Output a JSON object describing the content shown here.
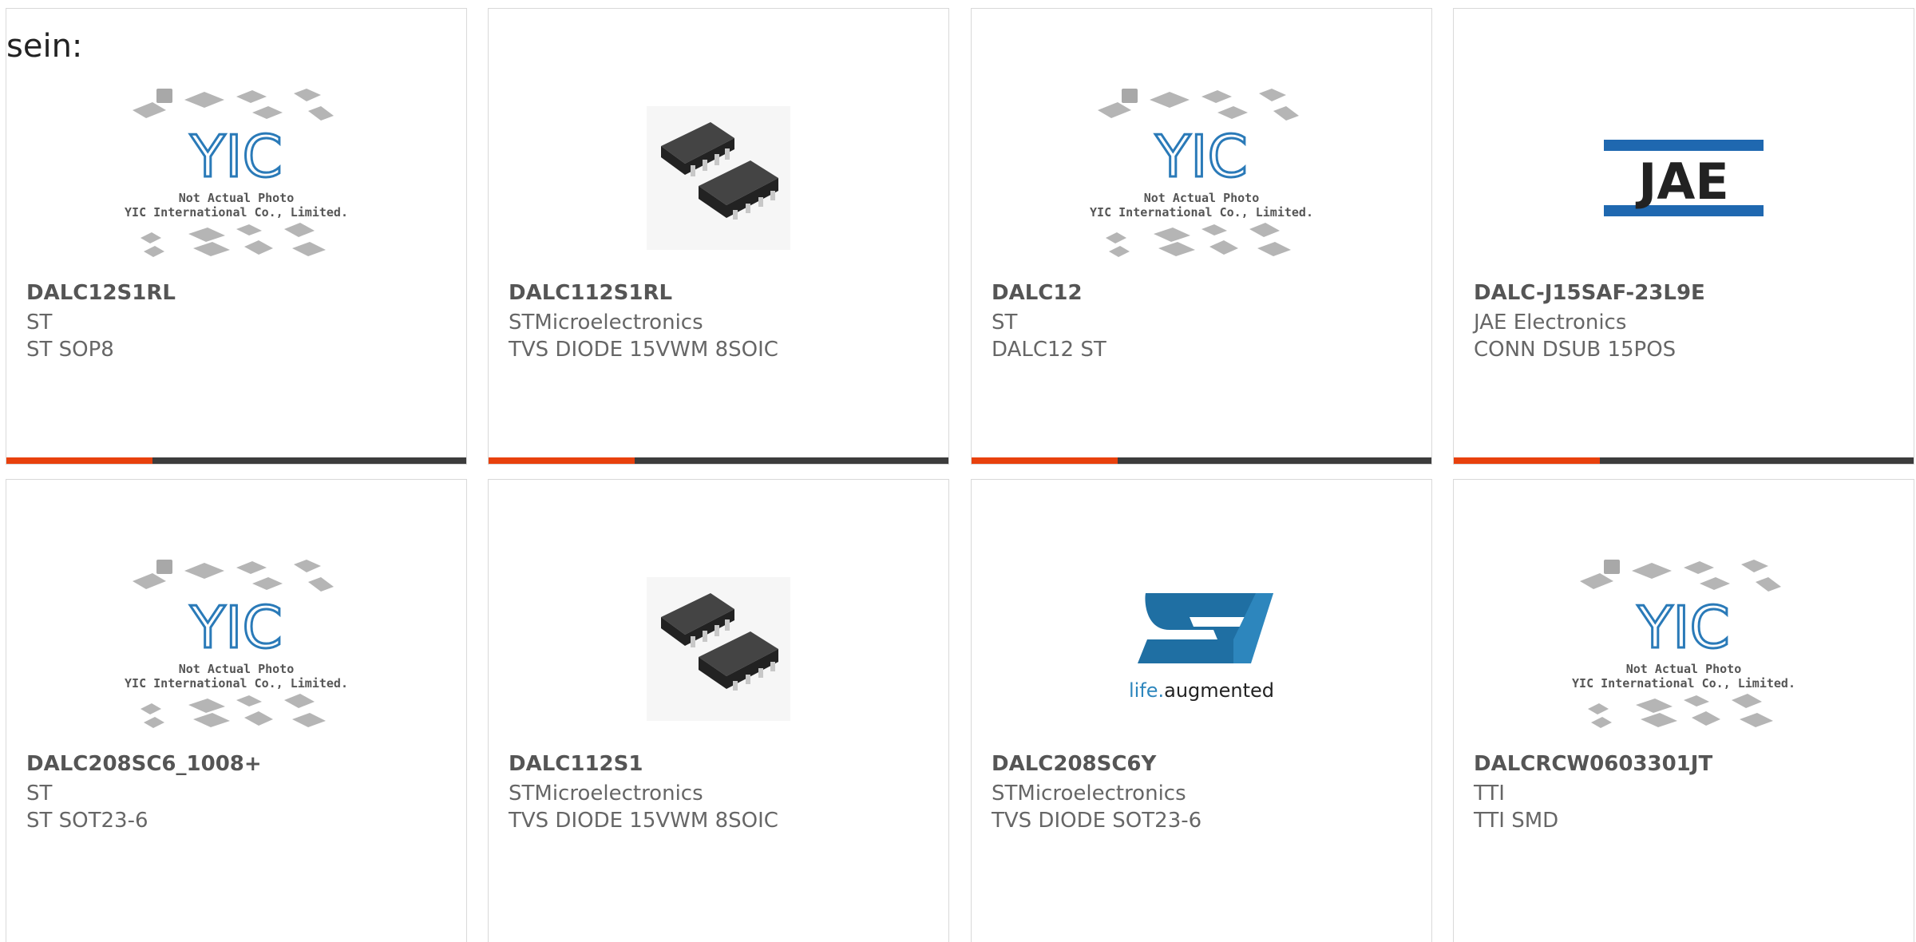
{
  "lead_text": "sein:",
  "colors": {
    "accent": "#e8410d",
    "bar": "#3c3c3c",
    "yic_blue": "#2a7ab8",
    "jae_blue": "#1f68b0",
    "st_blue": "#1f6fa3"
  },
  "placeholder": {
    "line1": "Not Actual Photo",
    "line2": "YIC International Co., Limited.",
    "logo_text": "YIC"
  },
  "jae_logo": "JAE",
  "st_logo": {
    "tagline_1": "life.",
    "tagline_2": "augmented"
  },
  "products": [
    {
      "part": "DALC12S1RL",
      "manufacturer": "ST",
      "description": "ST SOP8",
      "image": "placeholder-photo"
    },
    {
      "part": "DALC112S1RL",
      "manufacturer": "STMicroelectronics",
      "description": "TVS DIODE 15VWM 8SOIC",
      "image": "soic-chip"
    },
    {
      "part": "DALC12",
      "manufacturer": "ST",
      "description": "DALC12 ST",
      "image": "placeholder-photo"
    },
    {
      "part": "DALC-J15SAF-23L9E",
      "manufacturer": "JAE Electronics",
      "description": "CONN DSUB 15POS",
      "image": "jae-logo"
    },
    {
      "part": "DALC208SC6_1008+",
      "manufacturer": "ST",
      "description": "ST SOT23-6",
      "image": "placeholder-photo"
    },
    {
      "part": "DALC112S1",
      "manufacturer": "STMicroelectronics",
      "description": "TVS DIODE 15VWM 8SOIC",
      "image": "soic-chip"
    },
    {
      "part": "DALC208SC6Y",
      "manufacturer": "STMicroelectronics",
      "description": "TVS DIODE SOT23-6",
      "image": "st-logo"
    },
    {
      "part": "DALCRCW0603301JT",
      "manufacturer": "TTI",
      "description": "TTI SMD",
      "image": "placeholder-photo"
    }
  ]
}
